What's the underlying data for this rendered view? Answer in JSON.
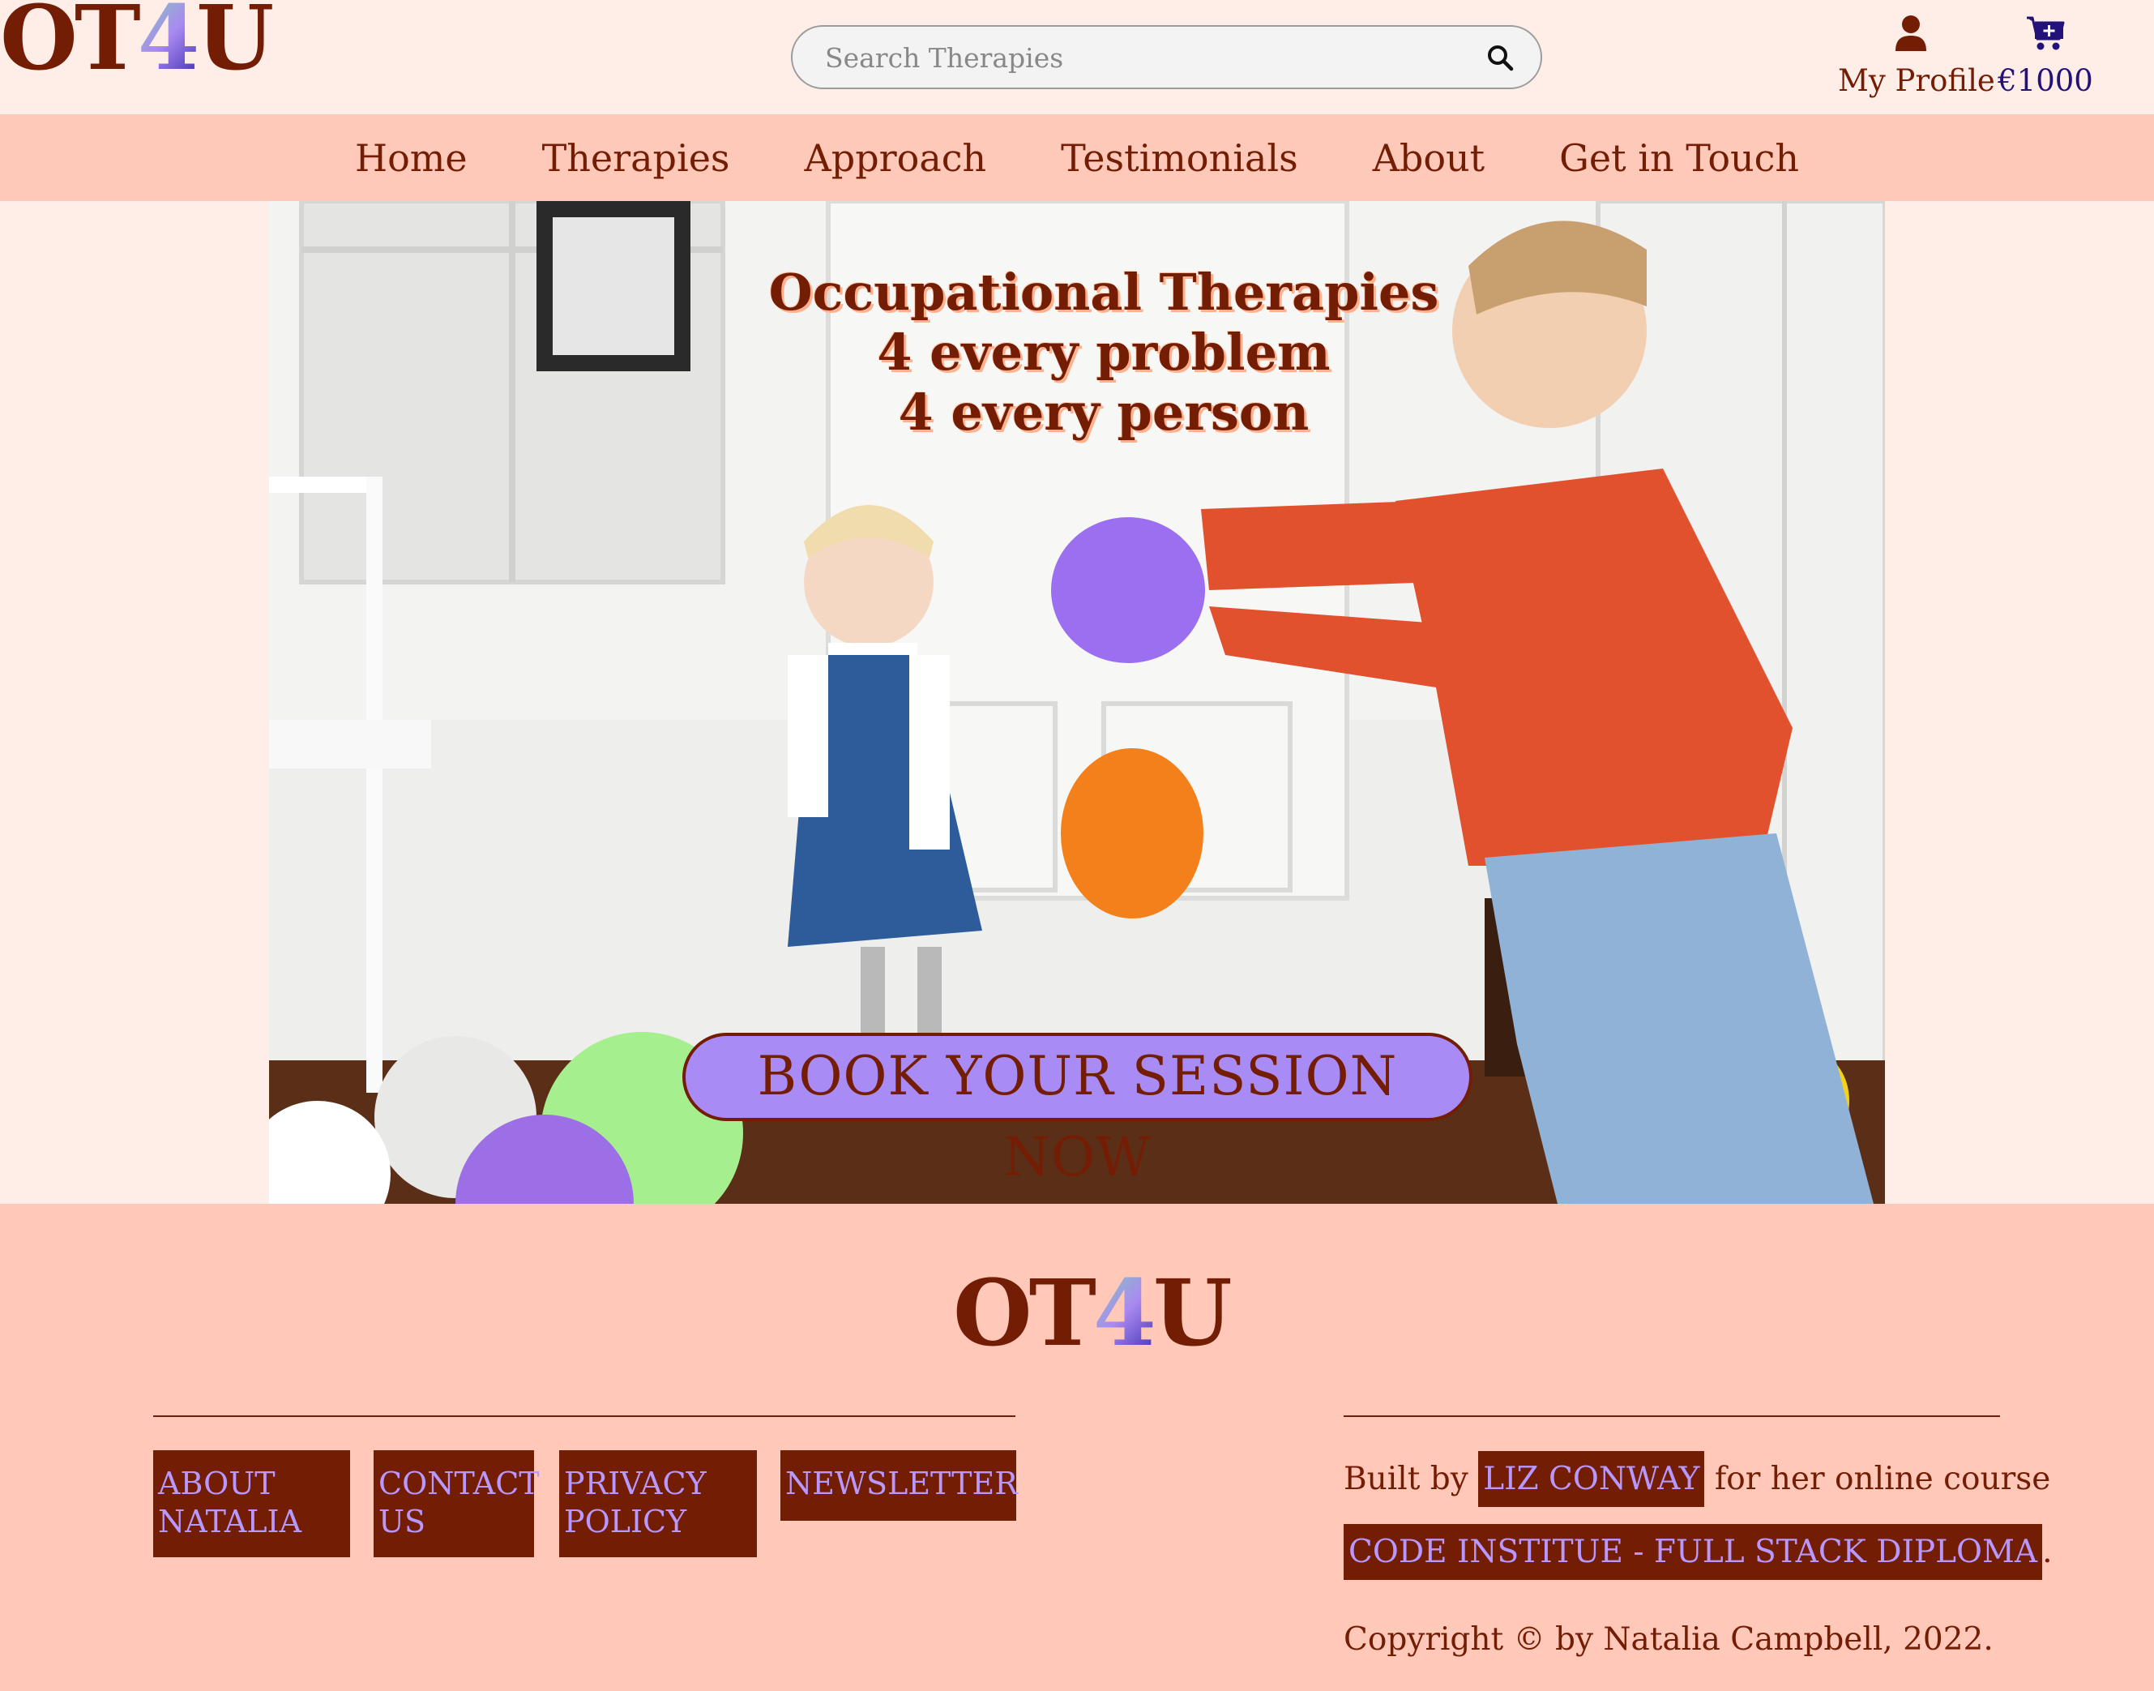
{
  "brand": {
    "logo_pre": "OT",
    "logo_four": "4",
    "logo_post": "U"
  },
  "header": {
    "search_placeholder": "Search Therapies",
    "profile_label": "My Profile",
    "cart_total": "€1000"
  },
  "nav": {
    "items": [
      {
        "label": "Home"
      },
      {
        "label": "Therapies"
      },
      {
        "label": "Approach"
      },
      {
        "label": "Testimonials"
      },
      {
        "label": "About"
      },
      {
        "label": "Get in Touch"
      }
    ]
  },
  "hero": {
    "headline": [
      "Occupational Therapies",
      "4 every problem",
      "4 every person"
    ],
    "cta_label": "BOOK YOUR SESSION NOW"
  },
  "footer": {
    "links": [
      {
        "label": "ABOUT NATALIA"
      },
      {
        "label": "CONTACT US"
      },
      {
        "label": "PRIVACY POLICY"
      },
      {
        "label": "NEWSLETTER"
      }
    ],
    "built_by_prefix": "Built by",
    "author_link": "LIZ CONWAY",
    "built_by_suffix": "for her online course",
    "course_link": "CODE INSTITUE - FULL STACK DIPLOMA",
    "course_suffix": ".",
    "copyright": "Copyright © by Natalia Campbell, 2022."
  },
  "colors": {
    "primary": "#741d05",
    "nav_bg": "#ffc9b9",
    "page_bg": "#ffeee8",
    "accent": "#a98bf6",
    "link_text": "#b898ff",
    "cart_text": "#22127a"
  },
  "icons": [
    "search-icon",
    "user-icon",
    "cart-icon"
  ]
}
